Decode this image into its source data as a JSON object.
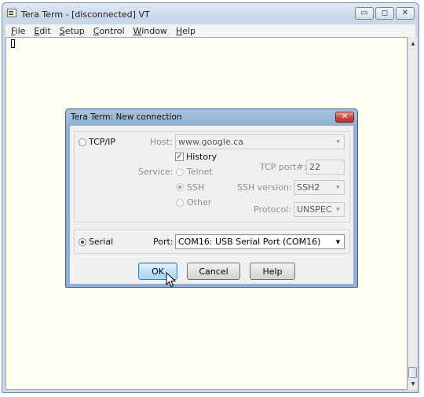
{
  "window": {
    "title": "Tera Term - [disconnected] VT",
    "min_glyph": "▭",
    "max_glyph": "◻",
    "close_glyph": "✕"
  },
  "menu": [
    {
      "mnemonic": "F",
      "rest": "ile"
    },
    {
      "mnemonic": "E",
      "rest": "dit"
    },
    {
      "mnemonic": "S",
      "rest": "etup"
    },
    {
      "mnemonic": "C",
      "rest": "ontrol"
    },
    {
      "mnemonic": "W",
      "rest": "indow"
    },
    {
      "mnemonic": "H",
      "rest": "elp"
    }
  ],
  "dialog": {
    "title": "Tera Term: New connection",
    "close_glyph": "✕",
    "tcpip": {
      "label": "TCP/IP",
      "selected": false,
      "host_label": "Host:",
      "host_value": "www.google.ca",
      "history_label": "History",
      "history_checked": true,
      "service_label": "Service:",
      "services": [
        "Telnet",
        "SSH",
        "Other"
      ],
      "selected_service": "SSH",
      "tcp_port_label": "TCP port#:",
      "tcp_port_value": "22",
      "ssh_version_label": "SSH version:",
      "ssh_version_value": "SSH2",
      "protocol_label": "Protocol:",
      "protocol_value": "UNSPEC"
    },
    "serial": {
      "label": "Serial",
      "selected": true,
      "port_label": "Port:",
      "port_value": "COM16: USB Serial Port (COM16)"
    },
    "buttons": {
      "ok": "OK",
      "cancel": "Cancel",
      "help": "Help"
    }
  },
  "icons": [
    "app-icon",
    "minimize-icon",
    "maximize-icon",
    "close-icon",
    "chevron-down-icon",
    "mouse-pointer-icon"
  ],
  "colors": {
    "terminal_bg": "#fefef1",
    "default_button": "#bfe1f6"
  }
}
